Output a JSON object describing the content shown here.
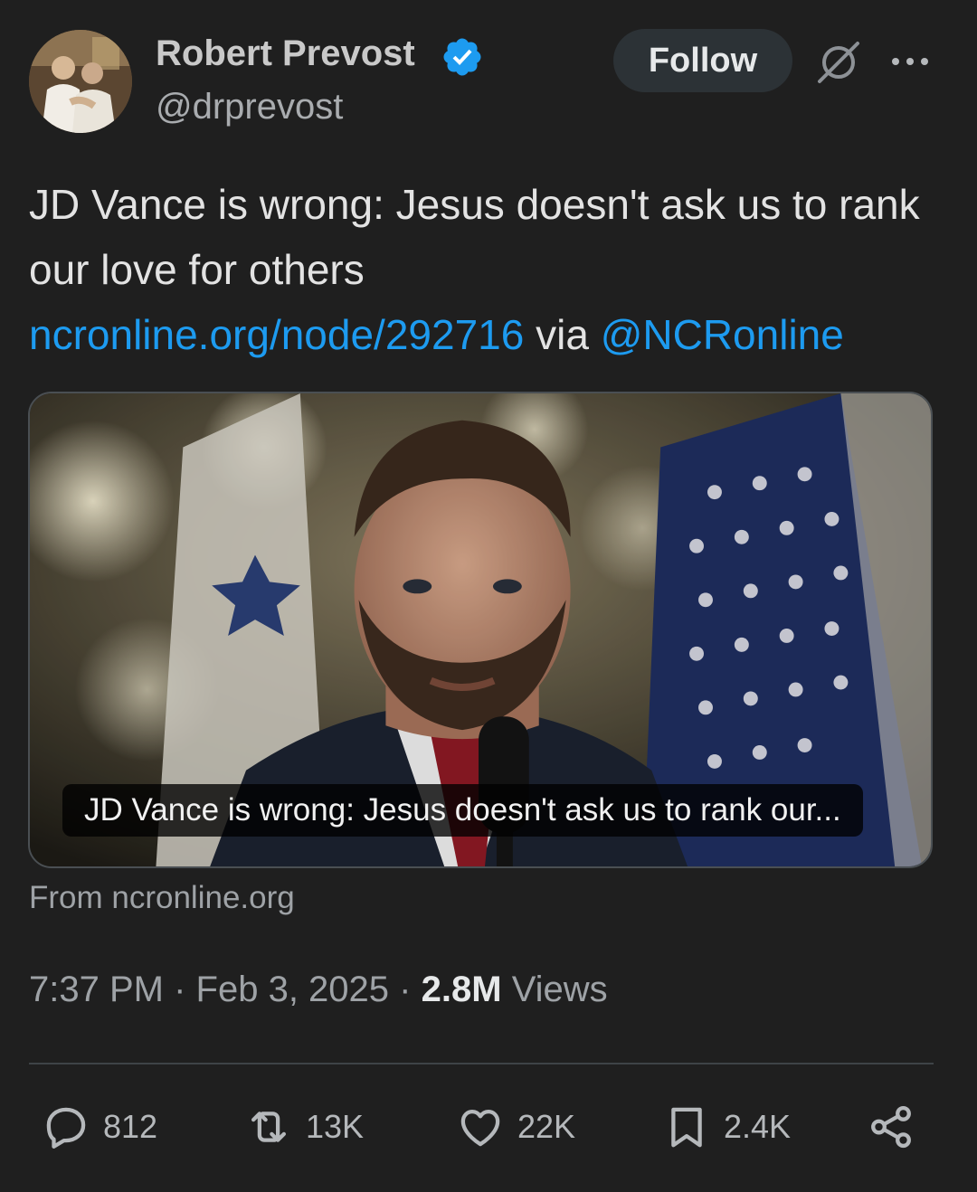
{
  "author": {
    "display_name": "Robert Prevost",
    "handle": "@drprevost",
    "verified_icon": "verified-badge-icon",
    "avatar_icon": "avatar-photo"
  },
  "header": {
    "follow_label": "Follow",
    "grok_icon": "grok-icon",
    "more_icon": "more-dots-icon"
  },
  "tweet": {
    "text": "JD Vance is wrong: Jesus doesn't ask us to rank our love for others",
    "link": "ncronline.org/node/292716",
    "via": "via",
    "mention": "@NCRonline"
  },
  "card": {
    "caption": "JD Vance is wrong: Jesus doesn't ask us to rank our...",
    "source": "From ncronline.org"
  },
  "meta": {
    "time": "7:37 PM",
    "date": "Feb 3, 2025",
    "sep": "·",
    "views_count": "2.8M",
    "views_label": "Views"
  },
  "actions": {
    "replies": "812",
    "reposts": "13K",
    "likes": "22K",
    "bookmarks": "2.4K"
  },
  "colors": {
    "background": "#1f1f1f",
    "link": "#1d9bf0",
    "verified": "#1d9bf0",
    "text": "#e7e9ea",
    "muted": "#9ea2a6"
  }
}
